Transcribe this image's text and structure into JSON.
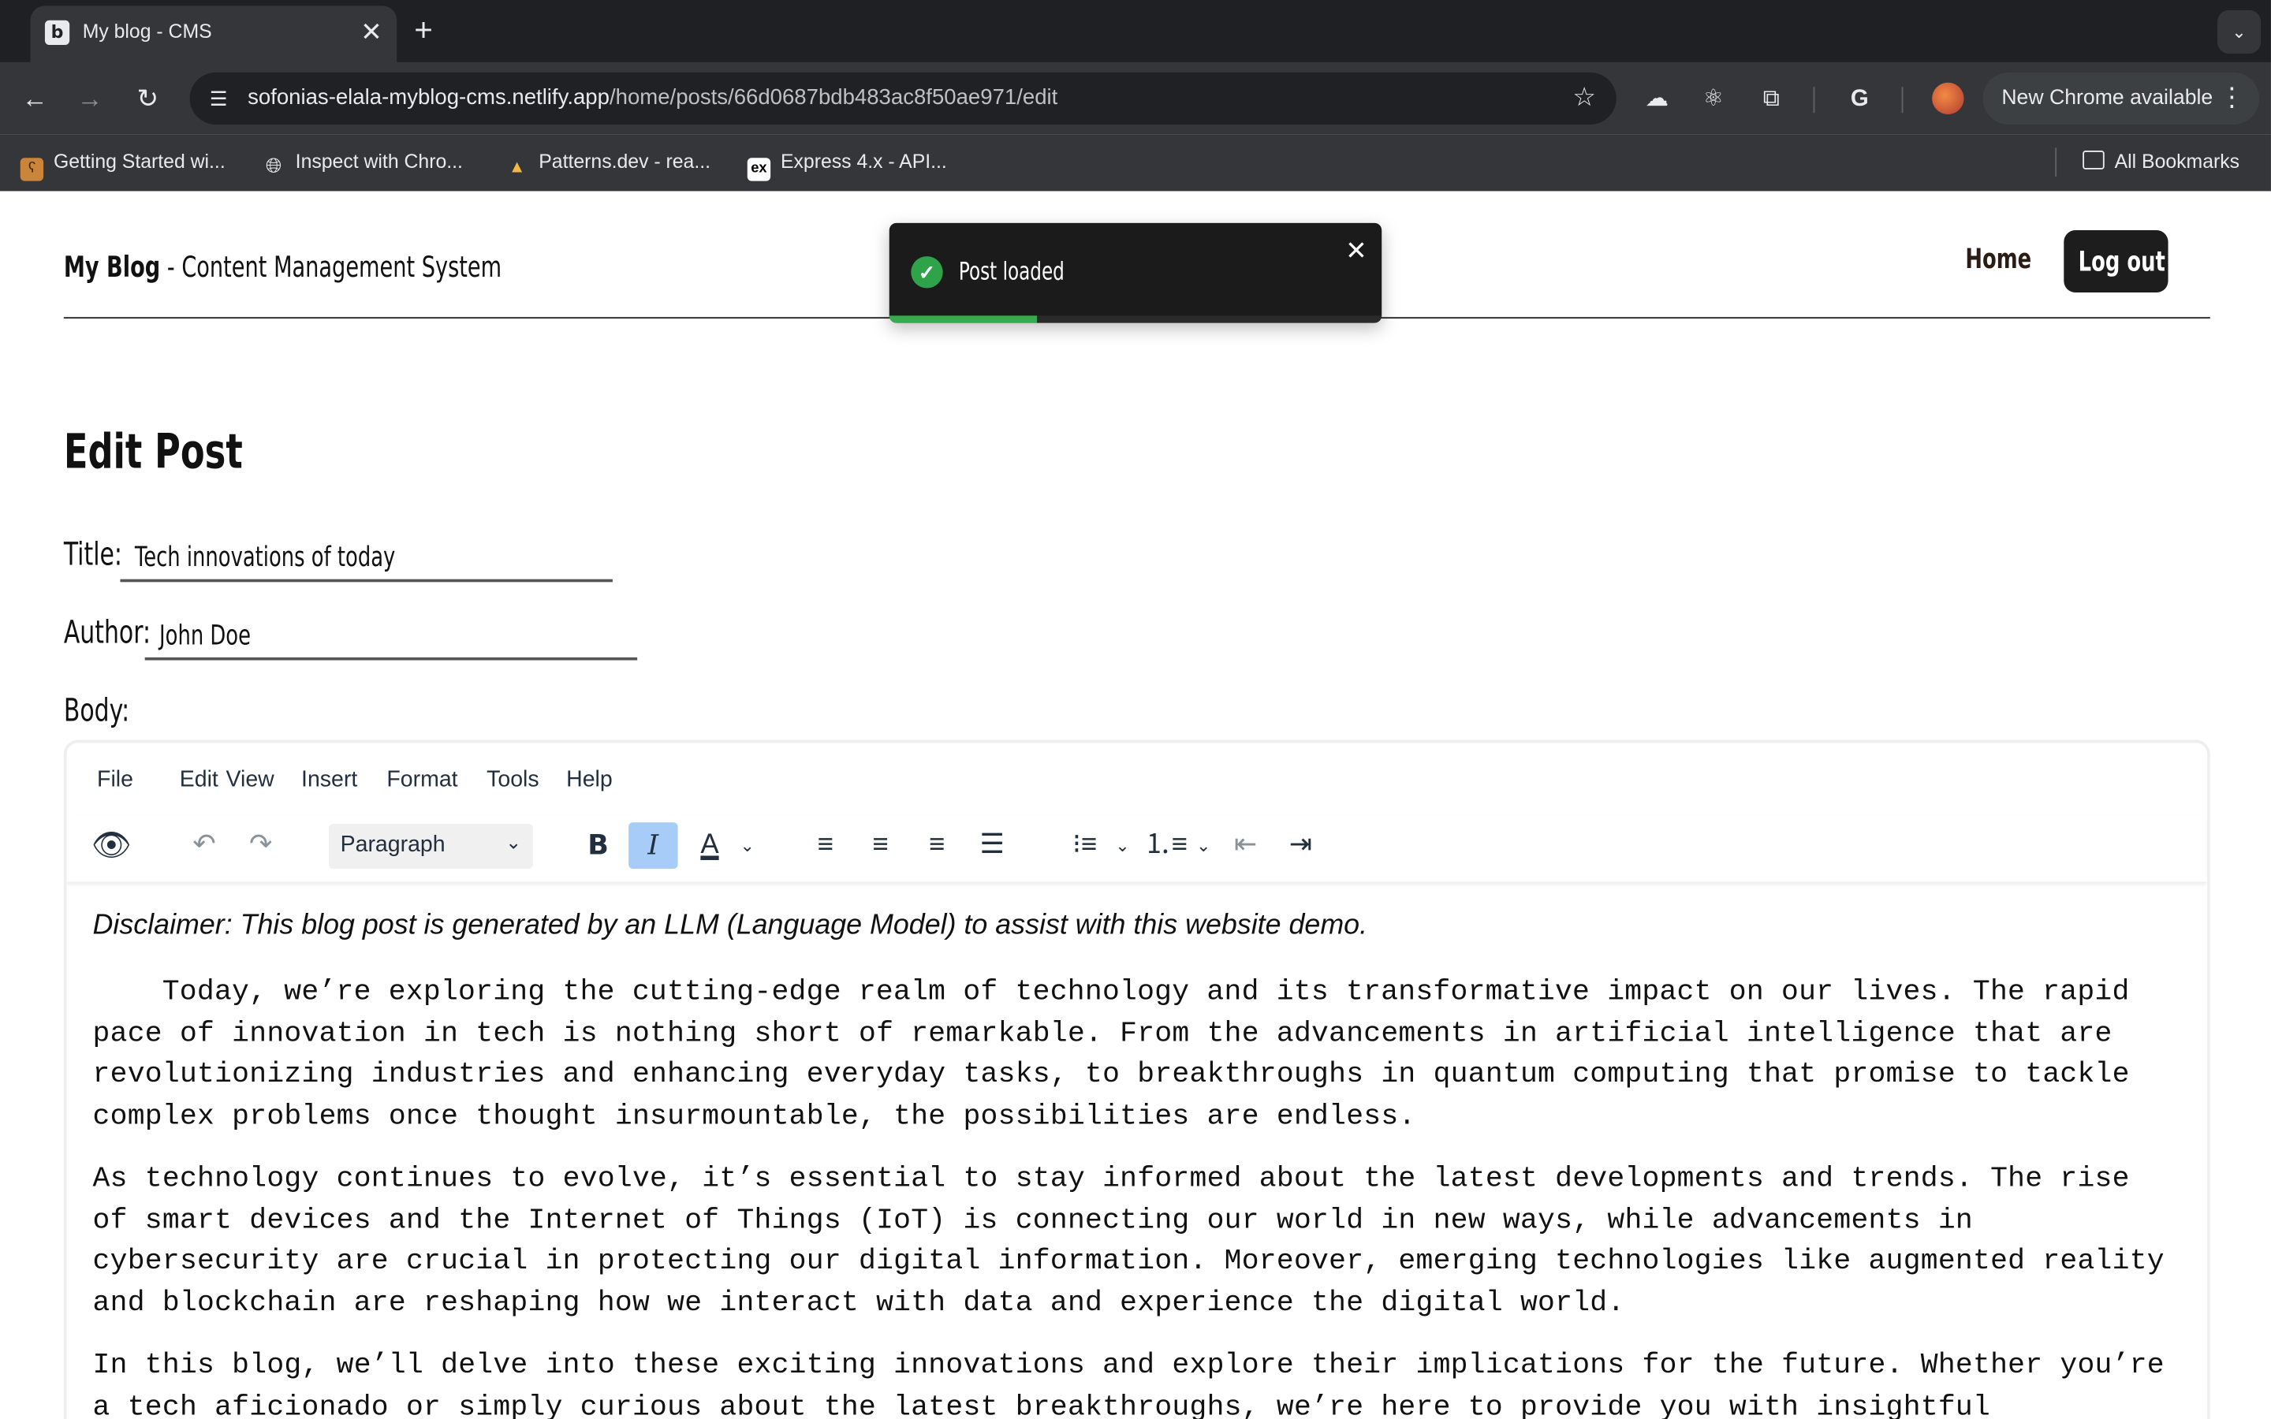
{
  "browser": {
    "tab_title": "My blog - CMS",
    "url_host": "sofonias-elala-myblog-cms.netlify.app",
    "url_path": "/home/posts/66d0687bdb483ac8f50ae971/edit",
    "update_label": "New Chrome available",
    "bookmarks": [
      {
        "label": "Getting Started wi...",
        "icon": "bear-icon"
      },
      {
        "label": "Inspect with Chro...",
        "icon": "globe-icon"
      },
      {
        "label": "Patterns.dev - rea...",
        "icon": "patterns-icon"
      },
      {
        "label": "Express 4.x - API...",
        "icon": "express-icon"
      }
    ],
    "all_bookmarks": "All Bookmarks"
  },
  "header": {
    "brand_strong": "My Blog",
    "brand_rest": " - Content Management System",
    "nav_home": "Home",
    "nav_logout": "Log out"
  },
  "toast": {
    "message": "Post loaded",
    "progress": 0.3,
    "colors": {
      "success": "#39a94e",
      "background": "#1b1b1b"
    }
  },
  "form": {
    "page_title": "Edit Post",
    "title_label": "Title:",
    "title_value": "Tech innovations of today",
    "author_label": "Author:",
    "author_value": "John Doe",
    "body_label": "Body:"
  },
  "editor": {
    "menus": [
      "File",
      "Edit",
      "View",
      "Insert",
      "Format",
      "Tools",
      "Help"
    ],
    "block_format": "Paragraph",
    "active_tool": "italic",
    "disclaimer": "Disclaimer: This blog post is generated by an LLM (Language Model) to assist with this website demo.",
    "paragraphs": [
      "Today, we’re exploring the cutting-edge realm of technology and its transformative impact on our lives. The rapid pace of innovation in tech is nothing short of remarkable. From the advancements in artificial intelligence that are revolutionizing industries and enhancing everyday tasks, to breakthroughs in quantum computing that promise to tackle complex problems once thought insurmountable, the possibilities are endless.",
      "As technology continues to evolve, it’s essential to stay informed about the latest developments and trends. The rise of smart devices and the Internet of Things (IoT) is connecting our world in new ways, while advancements in cybersecurity are crucial in protecting our digital information. Moreover, emerging technologies like augmented reality and blockchain are reshaping how we interact with data and experience the digital world.",
      "In this blog, we’ll delve into these exciting innovations and explore their implications for the future. Whether you’re a tech aficionado or simply curious about the latest breakthroughs, we’re here to provide you with insightful"
    ]
  }
}
